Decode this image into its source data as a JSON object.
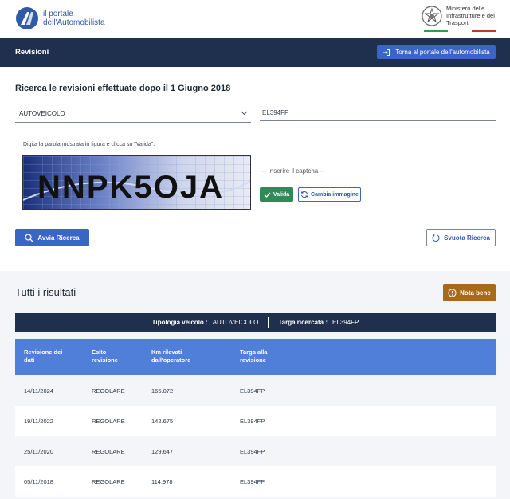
{
  "header": {
    "logo_line1": "il portale",
    "logo_line2": "dell'Automobilista",
    "ministry_line1": "Ministero delle",
    "ministry_line2": "Infrastrutture e dei",
    "ministry_line3": "Trasporti"
  },
  "nav": {
    "title": "Revisioni",
    "back_button": "Torna al portale dell'automobilista"
  },
  "search": {
    "title": "Ricerca le revisioni effettuate dopo il 1 Giugno 2018",
    "vehicle_type": "AUTOVEICOLO",
    "plate": "EL394FP",
    "captcha_hint": "Digita la parola mostrata in figura e clicca su \"Valida\".",
    "captcha_text": "NNPK5OJA",
    "captcha_placeholder": "-- Inserire il captcha --",
    "validate_label": "Valida",
    "change_image_label": "Cambia immagine",
    "search_button": "Avvia Ricerca",
    "clear_button": "Svuota Ricerca"
  },
  "results": {
    "title": "Tutti i risultati",
    "note_button": "Nota bene",
    "summary_type_label": "Tipologia veicolo :",
    "summary_type_value": "AUTOVEICOLO",
    "summary_plate_label": "Targa ricercata :",
    "summary_plate_value": "EL394FP",
    "columns": {
      "date_l1": "Revisione dei",
      "date_l2": "dati",
      "outcome_l1": "Esito",
      "outcome_l2": "revisione",
      "km_l1": "Km rilevati",
      "km_l2": "dall'operatore",
      "plate_l1": "Targa alla",
      "plate_l2": "revisione"
    },
    "rows": [
      {
        "date": "14/11/2024",
        "outcome": "REGOLARE",
        "km": "165.072",
        "plate": "EL394FP"
      },
      {
        "date": "19/11/2022",
        "outcome": "REGOLARE",
        "km": "142.675",
        "plate": "EL394FP"
      },
      {
        "date": "25/11/2020",
        "outcome": "REGOLARE",
        "km": "129.647",
        "plate": "EL394FP"
      },
      {
        "date": "05/11/2018",
        "outcome": "REGOLARE",
        "km": "114.978",
        "plate": "EL394FP"
      }
    ]
  },
  "colors": {
    "nav_bg": "#1f2f4e",
    "primary": "#3b64c7",
    "table_header": "#4f7fd9",
    "success": "#2e8b57",
    "warning": "#a66a1a"
  },
  "icons": {
    "logo": "road-logo-icon",
    "emblem": "republic-emblem-icon",
    "back": "login-arrow-icon",
    "chevron": "chevron-down-icon",
    "check": "check-icon",
    "refresh": "refresh-icon",
    "search": "search-icon",
    "reset": "reset-icon",
    "info": "info-icon"
  }
}
